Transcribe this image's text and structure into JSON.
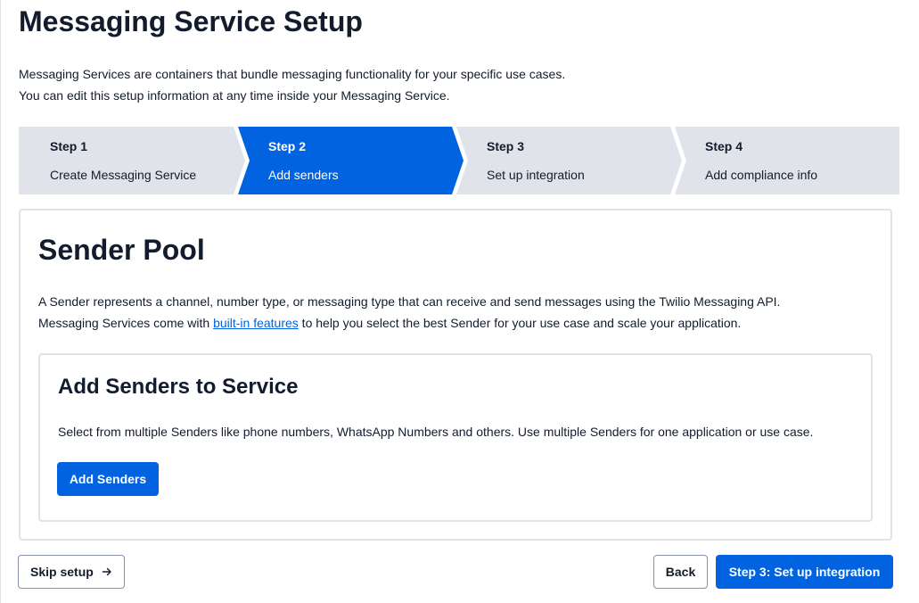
{
  "header": {
    "title": "Messaging Service Setup",
    "intro_line1": "Messaging Services are containers that bundle messaging functionality for your specific use cases.",
    "intro_line2": "You can edit this setup information at any time inside your Messaging Service."
  },
  "stepper": {
    "active_color": "#0263e0",
    "inactive_color": "#e1e3ea",
    "steps": [
      {
        "number": "Step 1",
        "label": "Create Messaging Service",
        "state": "complete"
      },
      {
        "number": "Step 2",
        "label": "Add senders",
        "state": "active"
      },
      {
        "number": "Step 3",
        "label": "Set up integration",
        "state": "upcoming"
      },
      {
        "number": "Step 4",
        "label": "Add compliance info",
        "state": "upcoming"
      }
    ]
  },
  "sender_pool": {
    "title": "Sender Pool",
    "desc_line1": "A Sender represents a channel, number type, or messaging type that can receive and send messages using the Twilio Messaging API.",
    "desc_line2_prefix": "Messaging Services come with ",
    "desc_link": "built-in features",
    "desc_line2_suffix": " to help you select the best Sender for your use case and scale your application."
  },
  "add_senders": {
    "title": "Add Senders to Service",
    "description": "Select from multiple Senders like phone numbers, WhatsApp Numbers and others. Use multiple Senders for one application or use case.",
    "button_label": "Add Senders"
  },
  "footer": {
    "skip_label": "Skip setup",
    "skip_icon": "arrow-right-icon",
    "back_label": "Back",
    "next_label": "Step 3: Set up integration"
  }
}
